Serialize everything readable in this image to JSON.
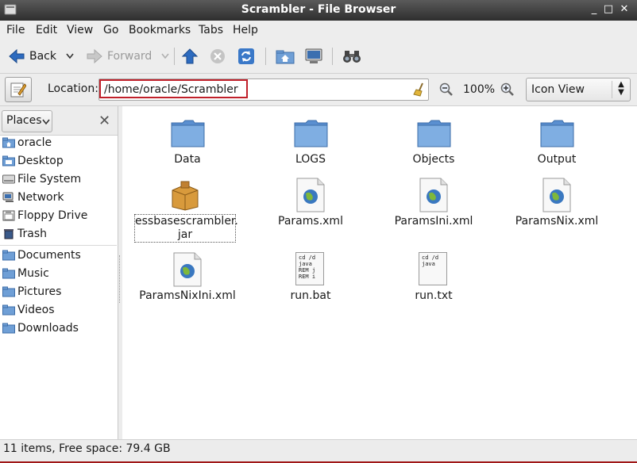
{
  "window": {
    "title": "Scrambler - File Browser",
    "minimize": "_",
    "maximize": "□",
    "close": "✕"
  },
  "menu": [
    "File",
    "Edit",
    "View",
    "Go",
    "Bookmarks",
    "Tabs",
    "Help"
  ],
  "toolbar": {
    "back": "Back",
    "forward": "Forward"
  },
  "location": {
    "label": "Location:",
    "path": "/home/oracle/Scrambler",
    "zoom": "100%",
    "view_mode": "Icon View"
  },
  "sidebar": {
    "header": "Places",
    "items": [
      {
        "label": "oracle",
        "icon": "home-folder-icon"
      },
      {
        "label": "Desktop",
        "icon": "desktop-folder-icon"
      },
      {
        "label": "File System",
        "icon": "filesystem-icon"
      },
      {
        "label": "Network",
        "icon": "network-icon"
      },
      {
        "label": "Floppy Drive",
        "icon": "floppy-icon"
      },
      {
        "label": "Trash",
        "icon": "trash-icon"
      },
      {
        "label": "Documents",
        "icon": "folder-icon"
      },
      {
        "label": "Music",
        "icon": "folder-icon"
      },
      {
        "label": "Pictures",
        "icon": "folder-icon"
      },
      {
        "label": "Videos",
        "icon": "folder-icon"
      },
      {
        "label": "Downloads",
        "icon": "folder-icon"
      }
    ]
  },
  "files": [
    {
      "name": "Data",
      "type": "folder"
    },
    {
      "name": "LOGS",
      "type": "folder"
    },
    {
      "name": "Objects",
      "type": "folder"
    },
    {
      "name": "Output",
      "type": "folder"
    },
    {
      "name": "essbasescrambler.",
      "name2": "jar",
      "type": "package"
    },
    {
      "name": "Params.xml",
      "type": "xml"
    },
    {
      "name": "ParamsIni.xml",
      "type": "xml"
    },
    {
      "name": "ParamsNix.xml",
      "type": "xml"
    },
    {
      "name": "ParamsNixIni.xml",
      "type": "xml"
    },
    {
      "name": "run.bat",
      "type": "text",
      "preview": [
        "cd /d",
        "java",
        "REM j",
        "REM i"
      ]
    },
    {
      "name": "run.txt",
      "type": "text",
      "preview": [
        "cd /d",
        "java"
      ]
    }
  ],
  "status": "11 items, Free space: 79.4 GB"
}
